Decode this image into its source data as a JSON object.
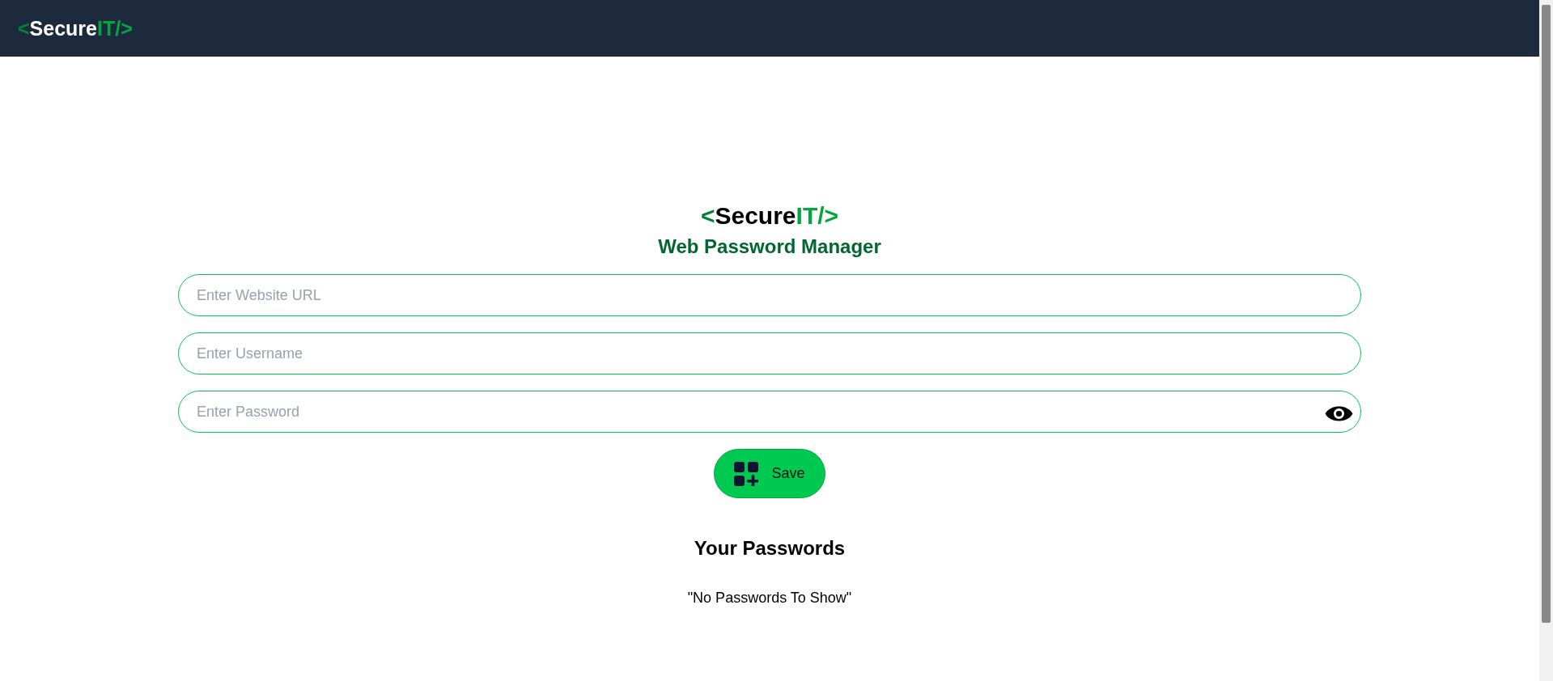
{
  "navbar": {
    "logo": [
      {
        "text": "<",
        "kind": "bracket"
      },
      {
        "text": "Secure",
        "kind": "name"
      },
      {
        "text": "IT/>",
        "kind": "accent"
      }
    ]
  },
  "header": {
    "logo": [
      {
        "text": "<",
        "kind": "bracket"
      },
      {
        "text": "Secure",
        "kind": "name"
      },
      {
        "text": "IT/>",
        "kind": "accent"
      }
    ],
    "subtitle": "Web Password Manager"
  },
  "form": {
    "fields": [
      {
        "placeholder": "Enter Website URL",
        "kind": "text"
      },
      {
        "placeholder": "Enter Username",
        "kind": "text"
      },
      {
        "placeholder": "Enter Password",
        "kind": "password"
      }
    ],
    "save_button": {
      "label": "Save"
    }
  },
  "passwords": {
    "heading": "Your Passwords",
    "empty_message": "\"No Passwords To Show\""
  }
}
